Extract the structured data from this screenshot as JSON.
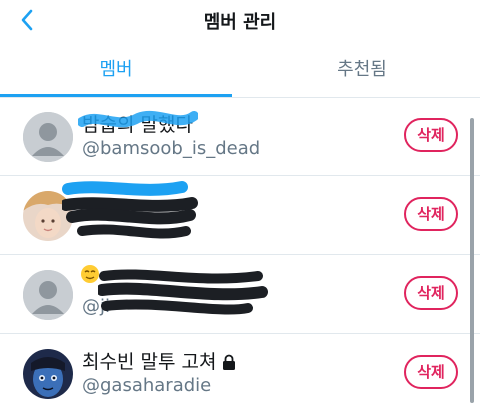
{
  "header": {
    "title": "멤버 관리",
    "back_icon": "chevron-left-icon"
  },
  "tabs": [
    {
      "label": "멤버",
      "active": true
    },
    {
      "label": "추천됨",
      "active": false
    }
  ],
  "members": [
    {
      "name": "밤숩의 말했다",
      "handle": "@bamsoob_is_dead",
      "delete_label": "삭제"
    },
    {
      "name": "",
      "handle": "",
      "delete_label": "삭제"
    },
    {
      "name": "",
      "handle": "@ji",
      "delete_label": "삭제"
    },
    {
      "name": "최수빈 말투 고쳐",
      "handle": "@gasaharadie",
      "delete_label": "삭제",
      "protected": true
    }
  ],
  "colors": {
    "accent": "#1da1f2",
    "delete": "#e0245e",
    "text": "#14171a",
    "secondary_text": "#657786",
    "divider": "#e1e8ed"
  }
}
